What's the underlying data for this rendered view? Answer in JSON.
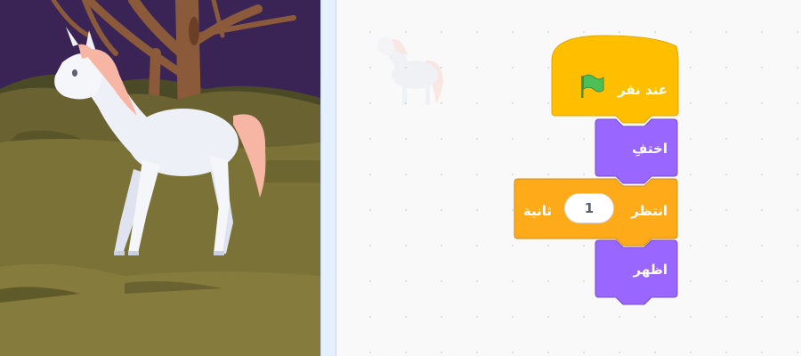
{
  "colors": {
    "events_block": "#ffbf00",
    "events_border": "#e0a800",
    "looks_block": "#9966ff",
    "looks_border": "#774dcb",
    "control_block": "#ffab19",
    "control_border": "#cf8b17",
    "flag": "#4cbf56",
    "workspace_bg": "#f9f9f9"
  },
  "stage": {
    "sprite_icon": "unicorn-sprite"
  },
  "script": {
    "hat_block": {
      "label": "عند نقر",
      "icon": "green-flag-icon"
    },
    "hide_block": {
      "label": "اختفِ"
    },
    "wait_block": {
      "label_before": "انتظر",
      "value": "1",
      "label_after": "ثانية"
    },
    "show_block": {
      "label": "اظهر"
    }
  }
}
